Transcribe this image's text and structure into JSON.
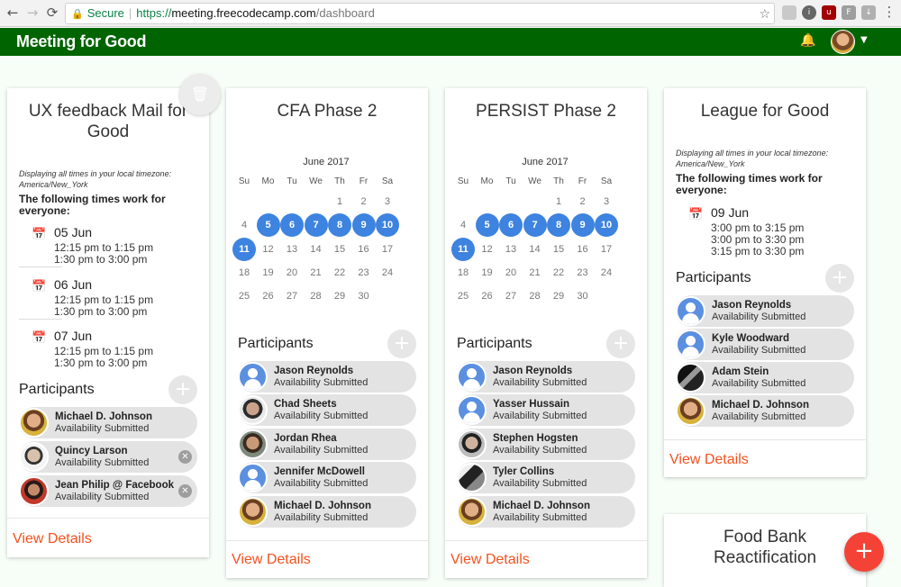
{
  "browser": {
    "back": "←",
    "forward": "→",
    "reload": "⟳",
    "secure_label": "Secure",
    "url_scheme": "https://",
    "url_host": "meeting.freecodecamp.com",
    "url_path": "/dashboard",
    "star": "☆",
    "extensions": [
      "cloud-icon",
      "info-icon",
      "ublock-icon",
      "f10-icon",
      "download-icon"
    ]
  },
  "app": {
    "title": "Meeting for Good",
    "bell": "🔔",
    "caret": "▼"
  },
  "cards": [
    {
      "title": "UX feedback Mail for Good",
      "tz_note": "Displaying all times in your local timezone: America/New_York",
      "works_text": "The following times work for everyone:",
      "dates": [
        {
          "date": "05 Jun",
          "times": [
            "12:15 pm to 1:15 pm",
            "1:30 pm to 3:00 pm"
          ]
        },
        {
          "date": "06 Jun",
          "times": [
            "12:15 pm to 1:15 pm",
            "1:30 pm to 3:00 pm"
          ]
        },
        {
          "date": "07 Jun",
          "times": [
            "12:15 pm to 1:15 pm",
            "1:30 pm to 3:00 pm"
          ]
        }
      ],
      "participants_label": "Participants",
      "participants": [
        {
          "name": "Michael D. Johnson",
          "status": "Availability Submitted"
        },
        {
          "name": "Quincy Larson",
          "status": "Availability Submitted"
        },
        {
          "name": "Jean Philip @ Facebook",
          "status": "Availability Submitted"
        }
      ],
      "view_details": "View Details"
    },
    {
      "title": "CFA Phase 2",
      "calendar": {
        "month": "June 2017",
        "weekdays": [
          "Su",
          "Mo",
          "Tu",
          "We",
          "Th",
          "Fr",
          "Sa"
        ],
        "selected": [
          5,
          6,
          7,
          8,
          9,
          10,
          11
        ]
      },
      "participants_label": "Participants",
      "participants": [
        {
          "name": "Jason Reynolds",
          "status": "Availability Submitted"
        },
        {
          "name": "Chad Sheets",
          "status": "Availability Submitted"
        },
        {
          "name": "Jordan Rhea",
          "status": "Availability Submitted"
        },
        {
          "name": "Jennifer McDowell",
          "status": "Availability Submitted"
        },
        {
          "name": "Michael D. Johnson",
          "status": "Availability Submitted"
        }
      ],
      "view_details": "View Details"
    },
    {
      "title": "PERSIST Phase 2",
      "calendar": {
        "month": "June 2017",
        "weekdays": [
          "Su",
          "Mo",
          "Tu",
          "We",
          "Th",
          "Fr",
          "Sa"
        ],
        "selected": [
          5,
          6,
          7,
          8,
          9,
          10,
          11
        ]
      },
      "participants_label": "Participants",
      "participants": [
        {
          "name": "Jason Reynolds",
          "status": "Availability Submitted"
        },
        {
          "name": "Yasser Hussain",
          "status": "Availability Submitted"
        },
        {
          "name": "Stephen Hogsten",
          "status": "Availability Submitted"
        },
        {
          "name": "Tyler Collins",
          "status": "Availability Submitted"
        },
        {
          "name": "Michael D. Johnson",
          "status": "Availability Submitted"
        }
      ],
      "view_details": "View Details"
    },
    {
      "title": "League for Good",
      "tz_note": "Displaying all times in your local timezone: America/New_York",
      "works_text": "The following times work for everyone:",
      "dates": [
        {
          "date": "09 Jun",
          "times": [
            "3:00 pm to 3:15 pm",
            "3:00 pm to 3:30 pm",
            "3:15 pm to 3:30 pm"
          ]
        }
      ],
      "participants_label": "Participants",
      "participants": [
        {
          "name": "Jason Reynolds",
          "status": "Availability Submitted"
        },
        {
          "name": "Kyle Woodward",
          "status": "Availability Submitted"
        },
        {
          "name": "Adam Stein",
          "status": "Availability Submitted"
        },
        {
          "name": "Michael D. Johnson",
          "status": "Availability Submitted"
        }
      ],
      "view_details": "View Details"
    },
    {
      "title": "Food Bank Reactification"
    }
  ],
  "icons": {
    "delete": "🗑",
    "calendar": "📅",
    "add": "+",
    "remove": "✕",
    "fab": "+"
  }
}
